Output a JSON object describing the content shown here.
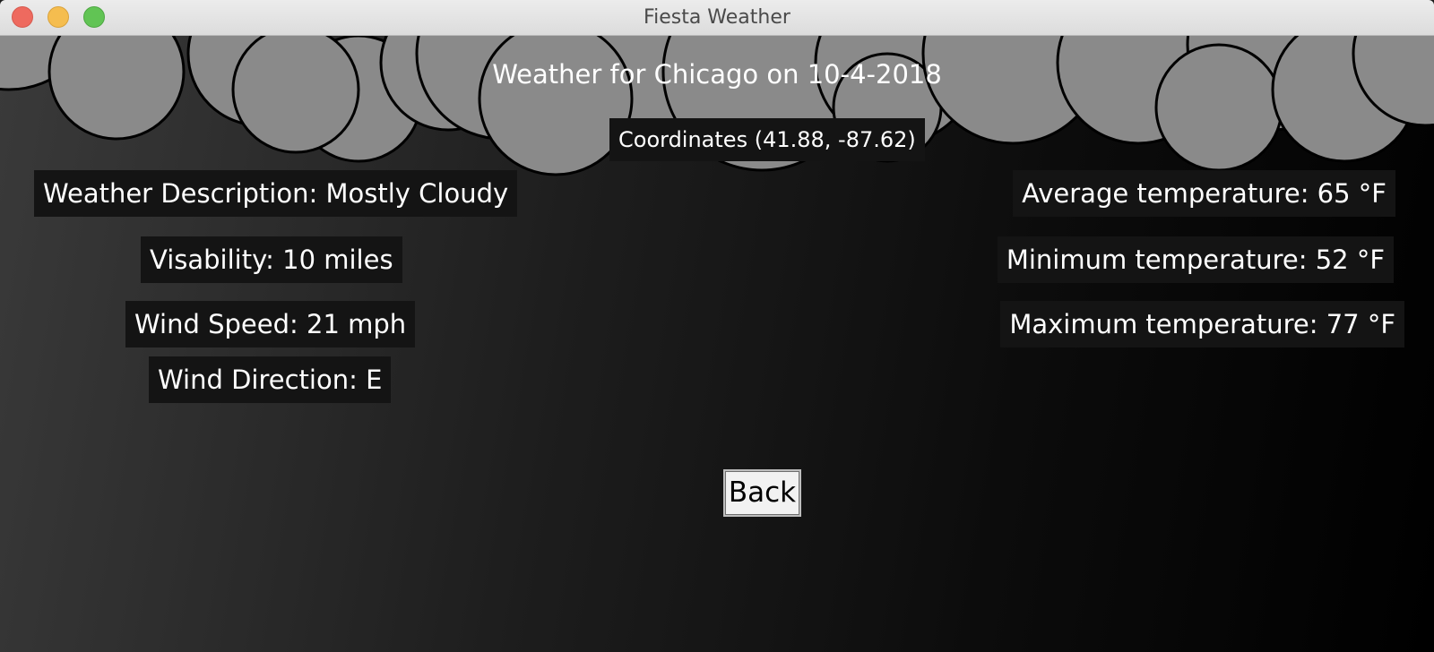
{
  "window": {
    "title": "Fiesta Weather"
  },
  "header": {
    "headline": "Weather for Chicago on 10-4-2018",
    "coordinates": "Coordinates (41.88, -87.62)"
  },
  "conditions": {
    "description": "Weather Description: Mostly Cloudy",
    "visibility": "Visability: 10 miles",
    "wind_speed": "Wind Speed: 21 mph",
    "wind_direction": "Wind Direction: E"
  },
  "temperatures": {
    "average": "Average temperature: 65 °F",
    "minimum": "Minimum temperature: 52 °F",
    "maximum": "Maximum temperature: 77 °F"
  },
  "actions": {
    "back_label": "Back"
  },
  "colors": {
    "cloud_fill": "#8a8a8a",
    "label_background": "#141414",
    "text": "#ffffff"
  }
}
